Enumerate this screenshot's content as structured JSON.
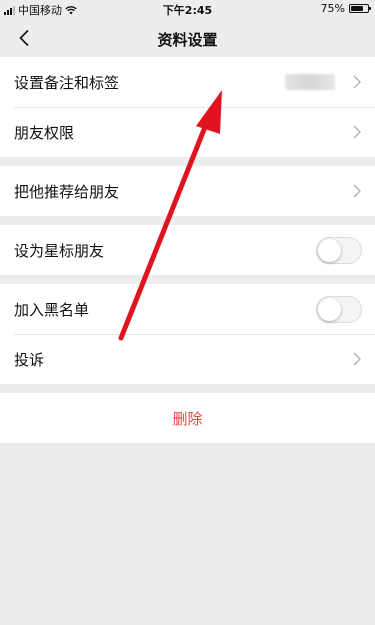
{
  "status_bar": {
    "carrier": "中国移动",
    "time": "下午2:45",
    "battery": "75%",
    "battery_level": 0.75
  },
  "nav": {
    "title": "资料设置",
    "back_icon": "chevron-left-icon"
  },
  "groups": [
    {
      "items": [
        {
          "label": "设置备注和标签",
          "type": "chevron",
          "value_blurred": true
        },
        {
          "label": "朋友权限",
          "type": "chevron"
        }
      ]
    },
    {
      "items": [
        {
          "label": "把他推荐给朋友",
          "type": "chevron"
        }
      ]
    },
    {
      "items": [
        {
          "label": "设为星标朋友",
          "type": "toggle",
          "checked": false
        }
      ]
    },
    {
      "items": [
        {
          "label": "加入黑名单",
          "type": "toggle",
          "checked": false
        },
        {
          "label": "投诉",
          "type": "chevron"
        }
      ]
    }
  ],
  "delete": {
    "label": "删除",
    "color": "#e64340"
  },
  "annotation": {
    "arrow_color": "#e0141e"
  }
}
